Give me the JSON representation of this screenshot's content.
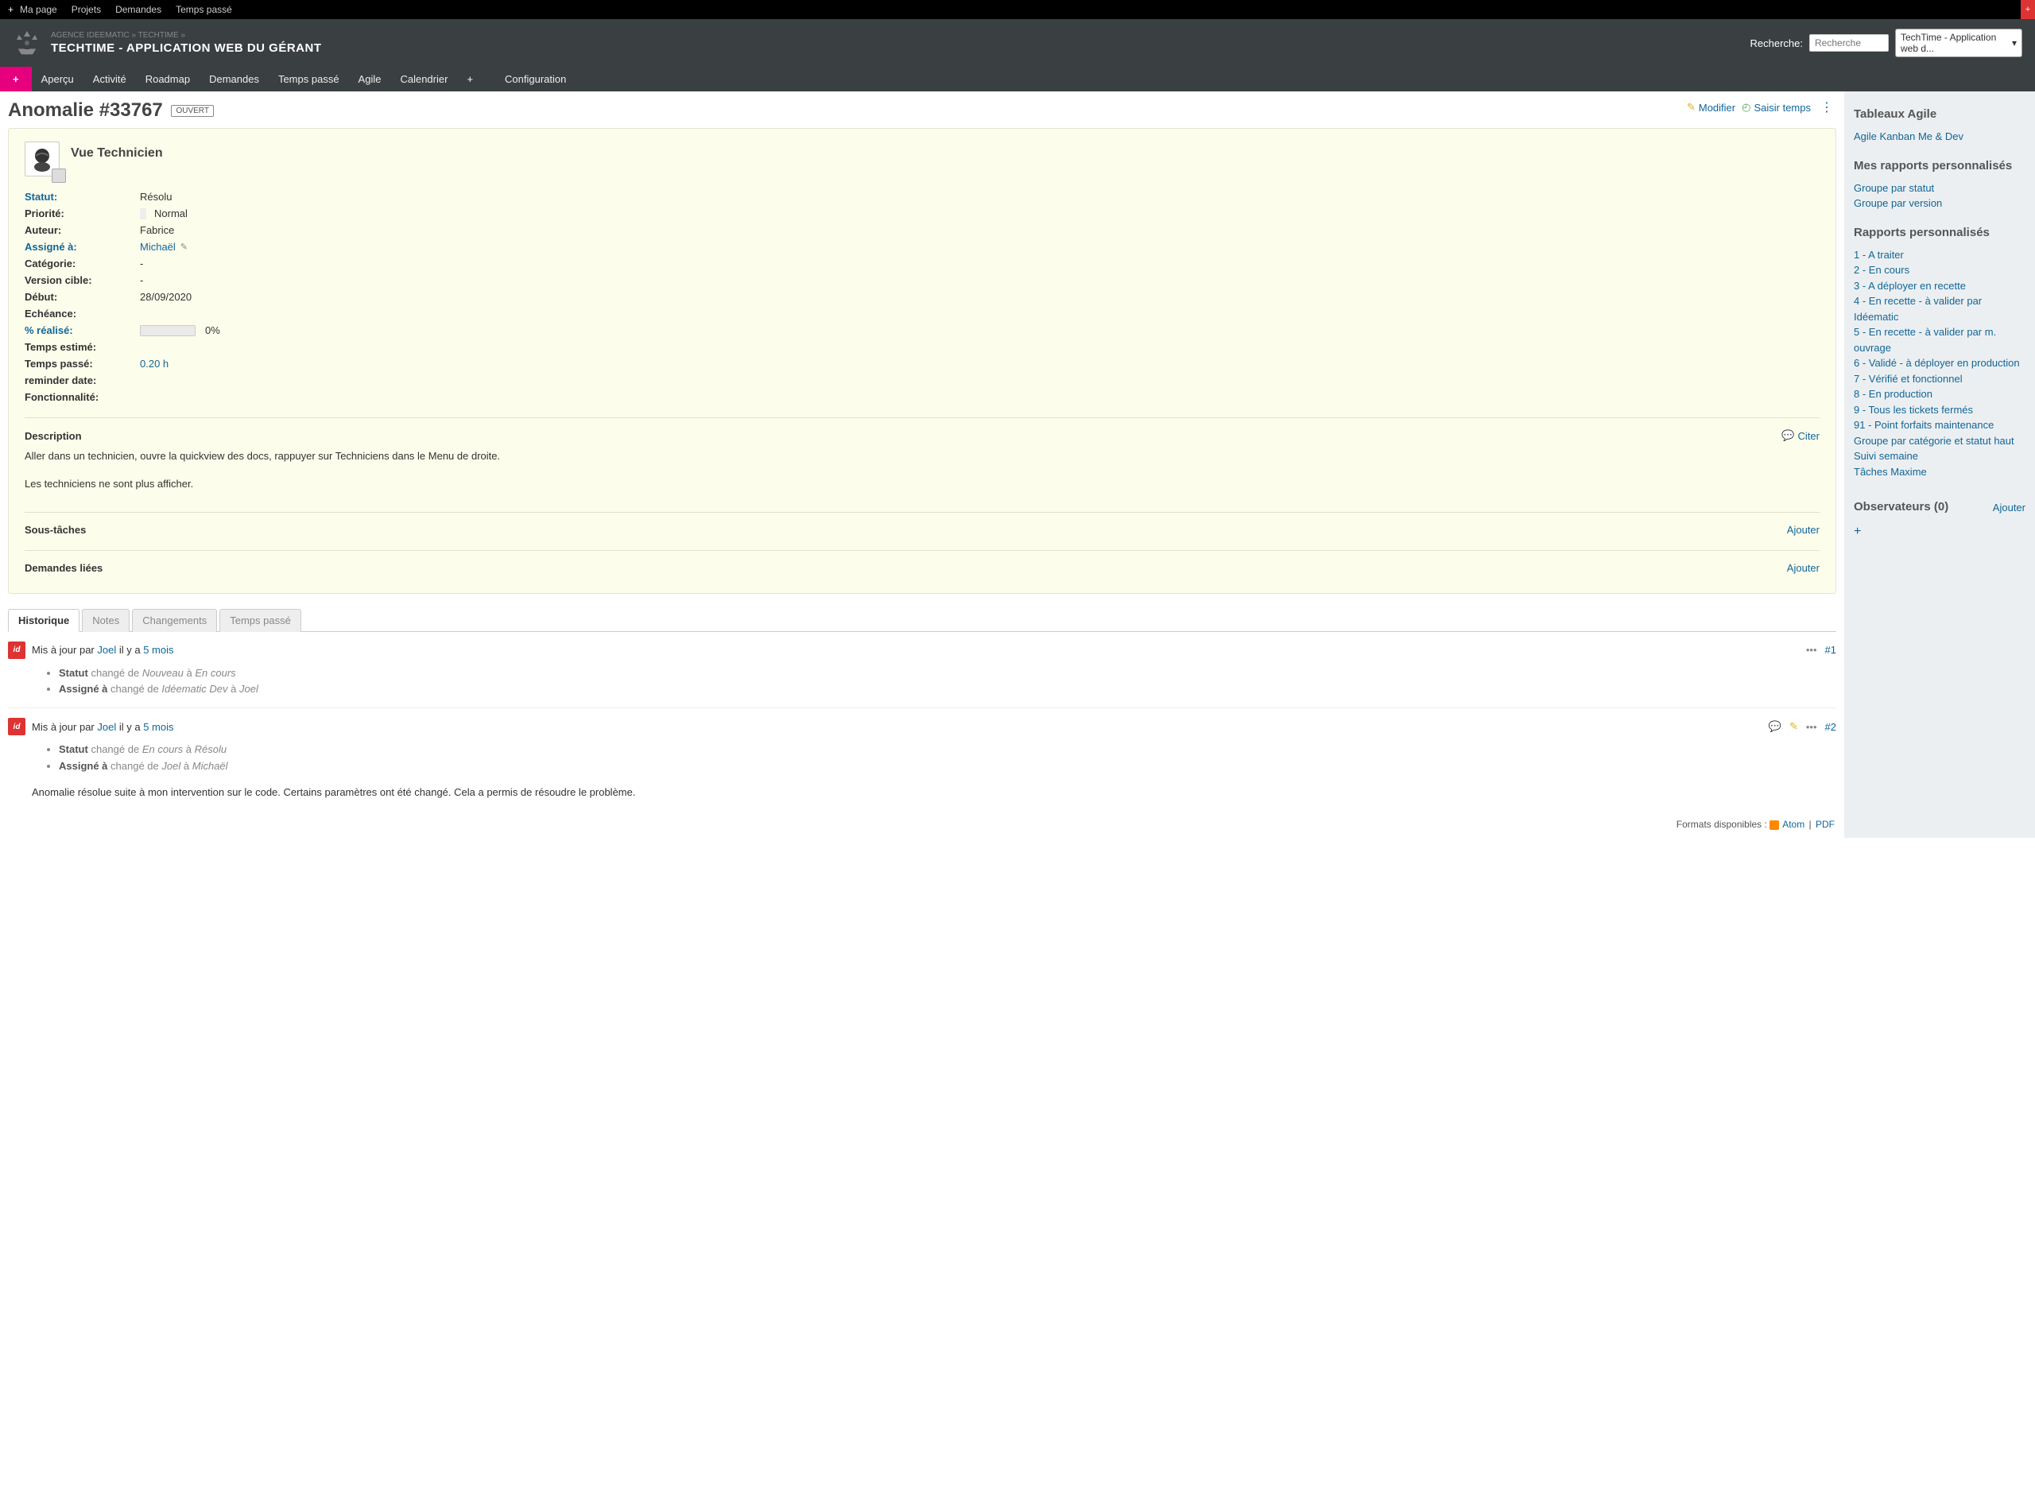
{
  "topbar": {
    "my_page": "Ma page",
    "projects": "Projets",
    "issues": "Demandes",
    "time": "Temps passé"
  },
  "header": {
    "breadcrumb": "AGENCE IDEEMATIC » TECHTIME »",
    "title": "TECHTIME - APPLICATION WEB DU GÉRANT",
    "search_label": "Recherche:",
    "search_placeholder": "Recherche",
    "project_select": "TechTime - Application web d..."
  },
  "nav": {
    "overview": "Aperçu",
    "activity": "Activité",
    "roadmap": "Roadmap",
    "issues": "Demandes",
    "time": "Temps passé",
    "agile": "Agile",
    "calendar": "Calendrier",
    "config": "Configuration"
  },
  "issue": {
    "title": "Anomalie #33767",
    "badge": "OUVERT",
    "subject": "Vue Technicien",
    "fields": {
      "status_label": "Statut:",
      "status_value": "Résolu",
      "priority_label": "Priorité:",
      "priority_value": "Normal",
      "author_label": "Auteur:",
      "author_value": "Fabrice",
      "assignee_label": "Assigné à:",
      "assignee_value": "Michaël",
      "category_label": "Catégorie:",
      "category_value": "-",
      "version_label": "Version cible:",
      "version_value": "-",
      "start_label": "Début:",
      "start_value": "28/09/2020",
      "due_label": "Echéance:",
      "due_value": "",
      "done_label": "% réalisé:",
      "done_value": "0%",
      "est_label": "Temps estimé:",
      "est_value": "",
      "spent_label": "Temps passé:",
      "spent_value": "0.20 h",
      "reminder_label": "reminder date:",
      "reminder_value": "",
      "func_label": "Fonctionnalité:",
      "func_value": ""
    },
    "description_title": "Description",
    "description_p1": "Aller dans un technicien, ouvre la quickview des docs, rappuyer sur Techniciens dans le Menu de droite.",
    "description_p2": "Les techniciens ne sont plus afficher.",
    "subtasks_title": "Sous-tâches",
    "related_title": "Demandes liées",
    "quote": "Citer",
    "add": "Ajouter"
  },
  "actions": {
    "edit": "Modifier",
    "log_time": "Saisir temps"
  },
  "tabs": {
    "history": "Historique",
    "notes": "Notes",
    "changes": "Changements",
    "time": "Temps passé"
  },
  "journal": {
    "updated_by": "Mis à jour par",
    "user": "Joel",
    "ago_prefix": "il y a",
    "ago_time": "5 mois",
    "e1": {
      "num": "#1",
      "l1_b": "Statut",
      "l1_mid": "changé de",
      "l1_i1": "Nouveau",
      "l1_to": "à",
      "l1_i2": "En cours",
      "l2_b": "Assigné à",
      "l2_mid": "changé de",
      "l2_i1": "Idéematic Dev",
      "l2_to": "à",
      "l2_i2": "Joel"
    },
    "e2": {
      "num": "#2",
      "l1_b": "Statut",
      "l1_mid": "changé de",
      "l1_i1": "En cours",
      "l1_to": "à",
      "l1_i2": "Résolu",
      "l2_b": "Assigné à",
      "l2_mid": "changé de",
      "l2_i1": "Joel",
      "l2_to": "à",
      "l2_i2": "Michaël",
      "note": "Anomalie résolue suite à mon intervention sur le code. Certains paramètres ont été changé. Cela a permis de résoudre le problème."
    }
  },
  "formats": {
    "label": "Formats disponibles :",
    "atom": "Atom",
    "pdf": "PDF"
  },
  "sidebar": {
    "agile_boards": "Tableaux Agile",
    "agile_link": "Agile Kanban Me & Dev",
    "my_reports": "Mes rapports personnalisés",
    "my_r1": "Groupe par statut",
    "my_r2": "Groupe par version",
    "custom_reports": "Rapports personnalisés",
    "r1": "1 - A traiter",
    "r2": "2 - En cours",
    "r3": "3 - A déployer en recette",
    "r4": "4 - En recette - à valider par Idéematic",
    "r5": "5 - En recette - à valider par m. ouvrage",
    "r6": "6 - Validé - à déployer en production",
    "r7": "7 - Vérifié et fonctionnel",
    "r8": "8 - En production",
    "r9": "9 - Tous les tickets fermés",
    "r10": "91 - Point forfaits maintenance",
    "r11": "Groupe par catégorie et statut haut",
    "r12": "Suivi semaine",
    "r13": "Tâches Maxime",
    "observers": "Observateurs (0)",
    "observers_add": "Ajouter"
  }
}
